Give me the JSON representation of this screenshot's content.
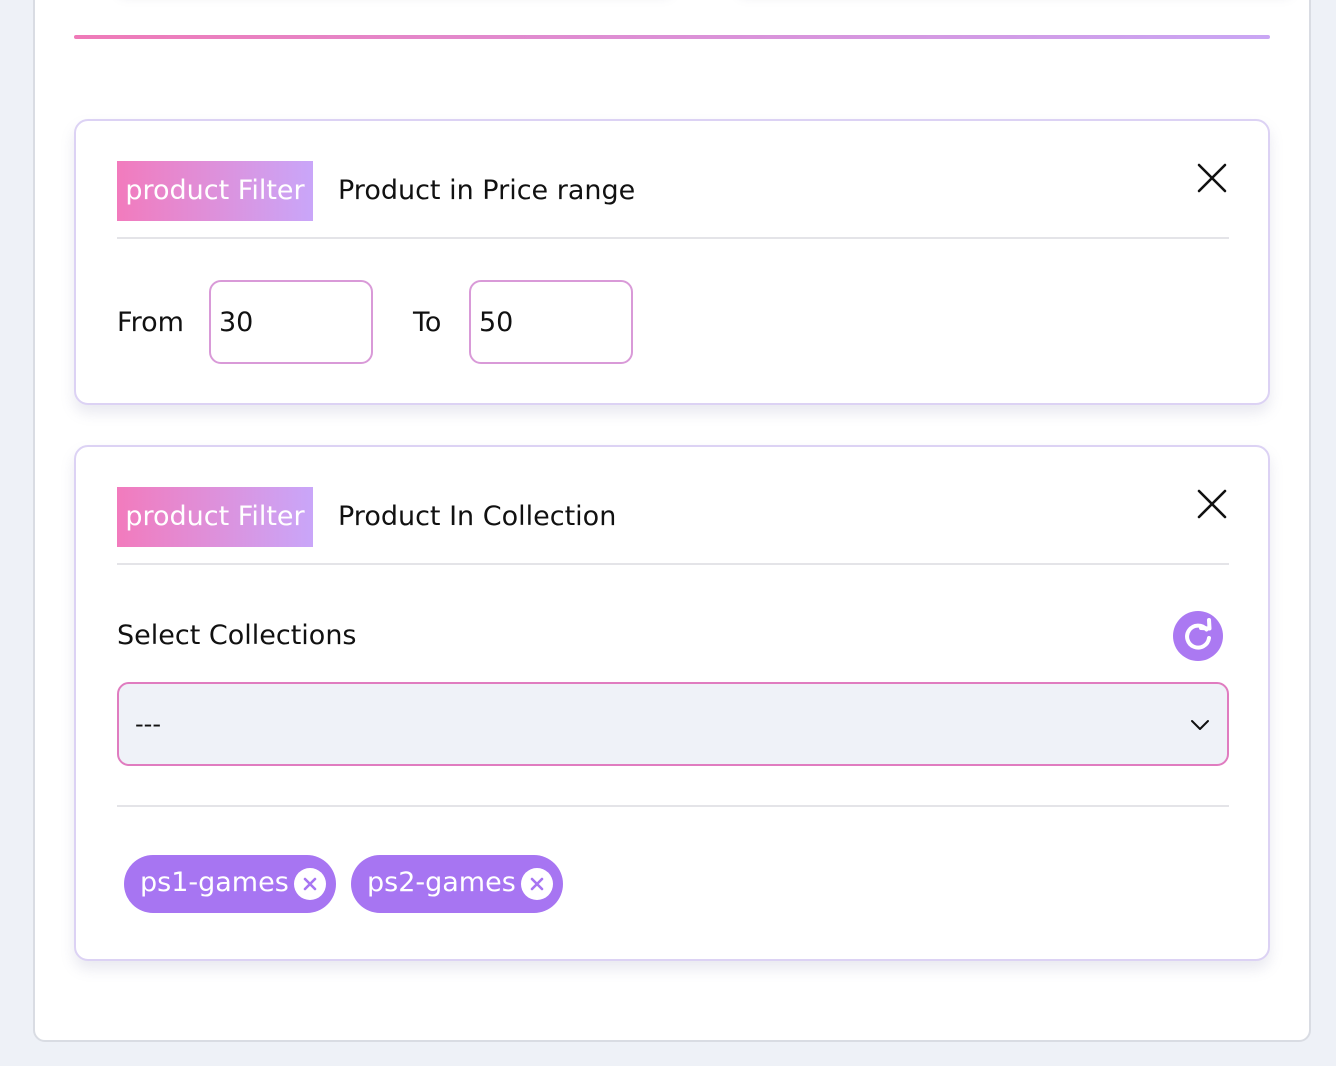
{
  "price_filter": {
    "badge": "product Filter",
    "title": "Product in Price range",
    "from_label": "From",
    "from_value": "30",
    "to_label": "To",
    "to_value": "50",
    "close_icon": "close-icon"
  },
  "collection_filter": {
    "badge": "product Filter",
    "title": "Product In Collection",
    "select_label": "Select Collections",
    "select_value": "---",
    "refresh_icon": "refresh-icon",
    "close_icon": "close-icon",
    "tags": [
      {
        "label": "ps1-games"
      },
      {
        "label": "ps2-games"
      }
    ]
  },
  "colors": {
    "accent_pink": "#f27bbd",
    "accent_purple": "#c9a6f9",
    "tag_purple": "#a775f2",
    "select_border": "#e07cc0"
  }
}
